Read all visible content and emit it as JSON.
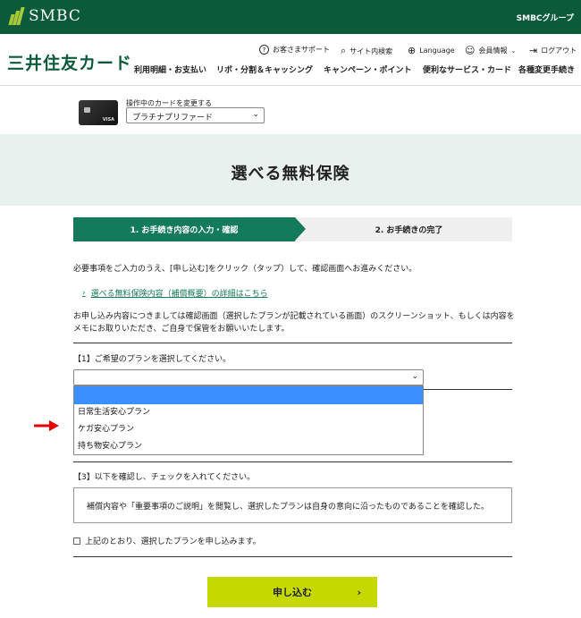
{
  "topbar": {
    "logo_text": "SMBC",
    "group_label": "SMBCグループ"
  },
  "header": {
    "brand": "三井住友カード",
    "utility": [
      {
        "label": "お客さまサポート",
        "icon": "question-icon"
      },
      {
        "label": "サイト内検索",
        "icon": "search-icon"
      },
      {
        "label": "Language",
        "icon": "globe-icon"
      },
      {
        "label": "会員情報",
        "icon": "user-icon"
      },
      {
        "label": "ログアウト",
        "icon": "logout-icon"
      }
    ],
    "nav": [
      "利用明細・お支払い",
      "リボ・分割＆キャッシング",
      "キャンペーン・ポイント",
      "便利なサービス・カード",
      "各種変更手続き"
    ]
  },
  "card": {
    "label": "操作中のカードを変更する",
    "selected": "プラチナプリファード",
    "card_brand": "VISA"
  },
  "page": {
    "title": "選べる無料保険"
  },
  "steps": [
    {
      "label": "1. お手続き内容の入力・確認"
    },
    {
      "label": "2. お手続きの完了"
    }
  ],
  "intro": {
    "line1": "必要事項をご入力のうえ、[申し込む]をクリック（タップ）して、確認画面へお進みください。",
    "link": "選べる無料保険内容（補償概要）の詳細はこちら",
    "note1": "お申し込み内容につきましては確認画面（選択したプランが記載されている画面）のスクリーンショット、もしくは内容を",
    "note2": "メモにお取りいただき、ご自身で保管をお願いいたします。"
  },
  "section1": {
    "label": "【1】ご希望のプランを選択してください。",
    "selected": ""
  },
  "dropdown": {
    "options": [
      "",
      "日常生活安心プラン",
      "ケガ安心プラン",
      "持ち物安心プラン"
    ]
  },
  "section3": {
    "label": "【3】以下を確認し、チェックを入れてください。",
    "confirm_text": "補償内容や「重要事項のご説明」を閲覧し、選択したプランは自身の意向に沿ったものであることを確認した。",
    "checkbox_label": "上記のとおり、選択したプランを申し込みます。"
  },
  "submit": {
    "label": "申し込む"
  },
  "colors": {
    "brand_green": "#0b5b3a",
    "step_green": "#137a5a",
    "submit_lime": "#c5d800",
    "arrow_red": "#e60000",
    "highlight_blue": "#3b8fff"
  }
}
